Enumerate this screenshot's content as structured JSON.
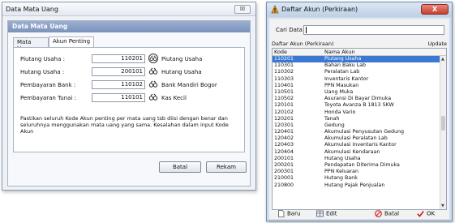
{
  "left_dialog": {
    "title": "Data Mata Uang",
    "close_label": "☒",
    "panel_title": "Data Mata Uang",
    "tabs": [
      {
        "label": "Mata Uang"
      },
      {
        "label": "Akun Penting"
      }
    ],
    "fields": [
      {
        "label": "Piutang Usaha :",
        "value": "110201",
        "desc": "Piutang Usaha"
      },
      {
        "label": "Hutang Usaha :",
        "value": "200101",
        "desc": "Hutang Usaha"
      },
      {
        "label": "Pembayaran Bank :",
        "value": "110102",
        "desc": "Bank Mandiri Bogor"
      },
      {
        "label": "Pembayaran Tunai :",
        "value": "110101",
        "desc": "Kas Kecil"
      }
    ],
    "note": "Pastikan seluruh Kode Akun penting per mata uang tsb diisi dengan benar dan seluruhnya menggunakan mata uang yang sama. Kesalahan dalam input Kode Akun",
    "buttons": {
      "batal": "Batal",
      "rekam": "Rekam"
    },
    "lookup_icon": "binoculars-icon"
  },
  "right_dialog": {
    "title": "Daftar Akun (Perkiraan)",
    "close_label": "X",
    "search_label": "Cari Data :",
    "search_value": "",
    "list_title": "Daftar Akun (Perkiraan)",
    "update_label": "Update",
    "columns": [
      "Kode",
      "Nama Akun"
    ],
    "selected_index": 0,
    "rows": [
      [
        "110201",
        "Piutang Usaha"
      ],
      [
        "110301",
        "Bahan Baku Lab"
      ],
      [
        "110302",
        "Peralatan Lab"
      ],
      [
        "110303",
        "Inventaris Kantor"
      ],
      [
        "110401",
        "PPN Masukan"
      ],
      [
        "110501",
        "Uang Muka"
      ],
      [
        "110502",
        "Asuransi Di Bayar Dimuka"
      ],
      [
        "120101",
        "Toyota Avanza B 1813 SKW"
      ],
      [
        "120102",
        "Honda Vario"
      ],
      [
        "120201",
        "Tanah"
      ],
      [
        "120301",
        "Gedung"
      ],
      [
        "120401",
        "Akumulasi Penyusutan Gedung"
      ],
      [
        "120402",
        "Akumulasi Peralatan Lab"
      ],
      [
        "120403",
        "Akumulasi Inventaris Kantor"
      ],
      [
        "120404",
        "Akumulasi Kendaraan"
      ],
      [
        "200101",
        "Hutang Usaha"
      ],
      [
        "200201",
        "Pendapatan Diterima Dimuka"
      ],
      [
        "200301",
        "PPN Keluaran"
      ],
      [
        "210001",
        "Hutang Bank"
      ],
      [
        "210800",
        "Hutang Pajak Penjualan"
      ]
    ],
    "buttons": {
      "baru": "Baru",
      "edit": "Edit",
      "batal": "Batal",
      "ok": "OK"
    }
  },
  "colors": {
    "selection": "#3a78d4",
    "panel_header": "#7b92bb",
    "close_red": "#c44030"
  }
}
